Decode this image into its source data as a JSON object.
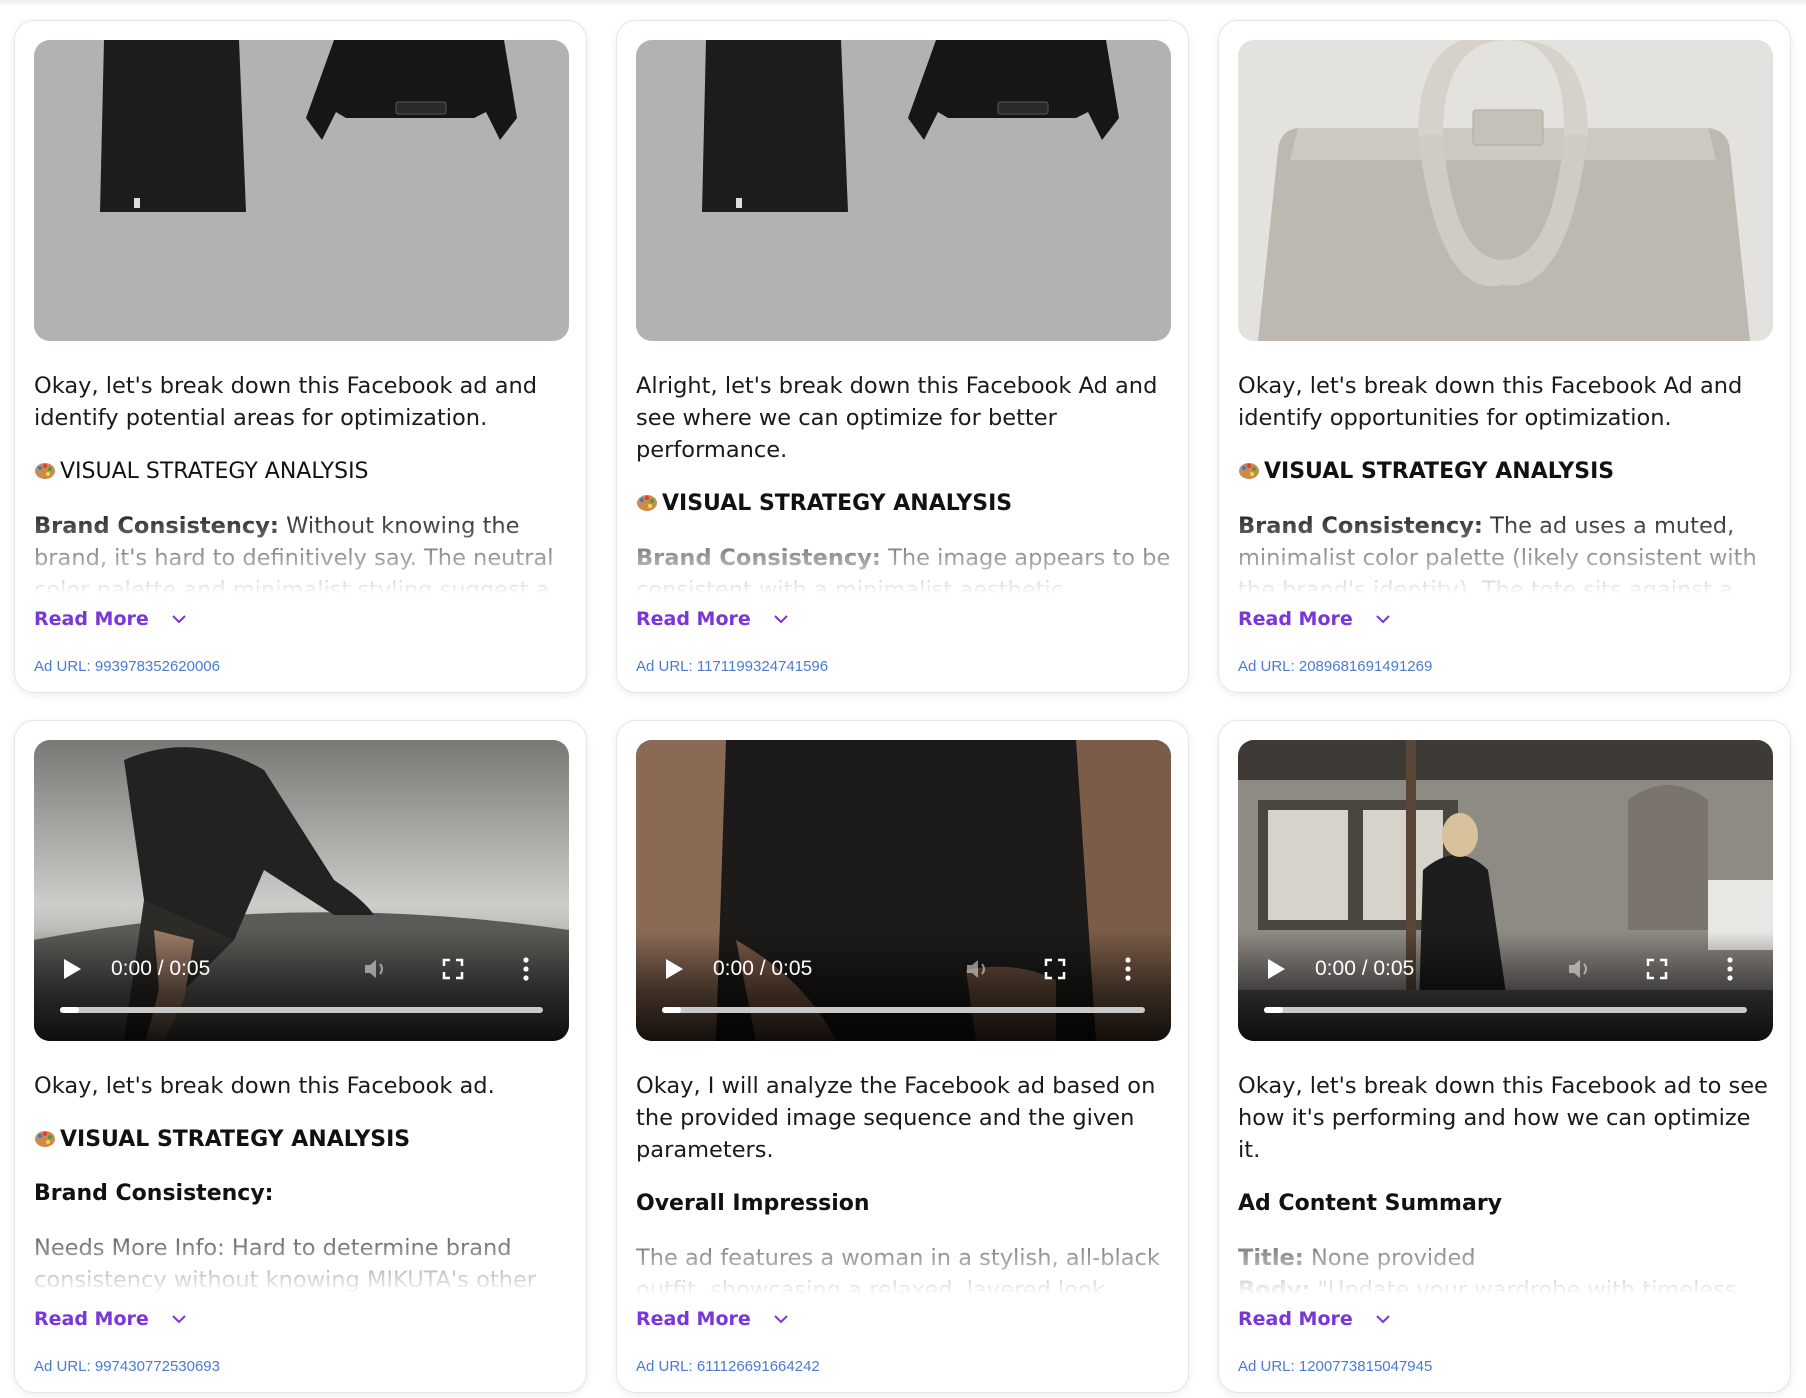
{
  "read_more_label": "Read More",
  "colors": {
    "accent": "#7a36d8",
    "url": "#4a7bd0"
  },
  "cards": [
    {
      "media_type": "image",
      "intro": "Okay, let's break down this Facebook ad and identify potential areas for optimization.",
      "section_heading": "VISUAL STRATEGY ANALYSIS",
      "label": "Brand Consistency:",
      "text": "Without knowing the brand, it's hard to definitively say. The neutral color palette and minimalist styling suggest a modern, understated aesthetic.",
      "ad_url": "Ad URL: 993978352620006"
    },
    {
      "media_type": "image",
      "intro": "Alright, let's break down this Facebook Ad and see where we can optimize for better performance.",
      "section_heading": "VISUAL STRATEGY ANALYSIS",
      "label": "Brand Consistency:",
      "text": "The image appears to be consistent with a minimalist aesthetic, focusing on neutral tones.",
      "ad_url": "Ad URL: 1171199324741596"
    },
    {
      "media_type": "image",
      "intro": "Okay, let's break down this Facebook Ad and identify opportunities for optimization.",
      "section_heading": "VISUAL STRATEGY ANALYSIS",
      "label": "Brand Consistency:",
      "text": "The ad uses a muted, minimalist color palette (likely consistent with the brand's identity). The tote sits against a plain backdrop.",
      "ad_url": "Ad URL: 2089681691491269"
    },
    {
      "media_type": "video",
      "video_time": "0:00 / 0:05",
      "progress": 0.04,
      "intro": "Okay, let's break down this Facebook ad.",
      "section_heading": "VISUAL STRATEGY ANALYSIS",
      "subheading": "Brand Consistency:",
      "text": "Needs More Info: Hard to determine brand consistency without knowing MIKUTA's other creatives.",
      "ad_url": "Ad URL: 997430772530693"
    },
    {
      "media_type": "video",
      "video_time": "0:00 / 0:05",
      "progress": 0.04,
      "intro": "Okay, I will analyze the Facebook ad based on the provided image sequence and the given parameters.",
      "subheading": "Overall Impression",
      "text": "The ad features a woman in a stylish, all-black outfit, showcasing a relaxed, layered look.",
      "ad_url": "Ad URL: 611126691664242"
    },
    {
      "media_type": "video",
      "video_time": "0:00 / 0:05",
      "progress": 0.04,
      "intro": "Okay, let's break down this Facebook ad to see how it's performing and how we can optimize it.",
      "subheading": "Ad Content Summary",
      "title_label": "Title:",
      "title_value": "None provided",
      "body_label": "Body:",
      "body_value": "\"Update your wardrobe with timeless pieces 🖤\"",
      "ad_url": "Ad URL: 1200773815047945"
    }
  ]
}
